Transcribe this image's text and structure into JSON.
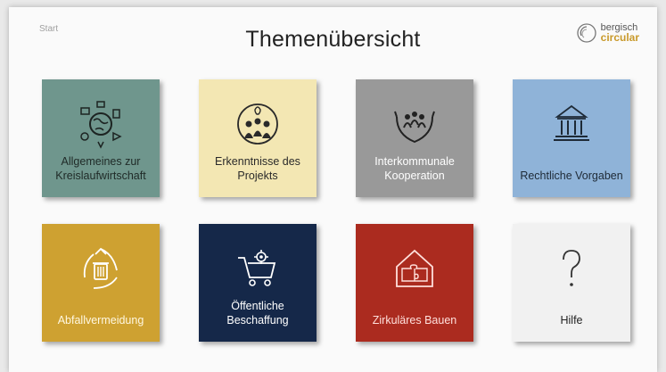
{
  "header": {
    "start_label": "Start",
    "title": "Themenübersicht",
    "logo_line1": "bergisch",
    "logo_line2": "circular"
  },
  "tiles": [
    {
      "label": "Allgemeines zur Kreislaufwirtschaft",
      "color": "#6f968d",
      "text_color": "#1f2a27",
      "icon": "earth-icons"
    },
    {
      "label": "Erkenntnisse des Projekts",
      "color": "#f3e7b3",
      "text_color": "#2a2a2a",
      "icon": "people-lightbulb-icon"
    },
    {
      "label": "Interkommunale Kooperation",
      "color": "#999999",
      "text_color": "#ffffff",
      "icon": "hands-people-icon"
    },
    {
      "label": "Rechtliche Vorgaben",
      "color": "#8fb3d8",
      "text_color": "#1e2a36",
      "icon": "courthouse-icon"
    },
    {
      "label": "Abfallvermeidung",
      "color": "#cea131",
      "text_color": "#fff7e0",
      "icon": "recycle-bin-icon"
    },
    {
      "label": "Öffentliche Beschaffung",
      "color": "#152849",
      "text_color": "#ffffff",
      "icon": "shopping-cart-gear-icon"
    },
    {
      "label": "Zirkuläres Bauen",
      "color": "#ab2b1f",
      "text_color": "#ffe0dc",
      "icon": "house-puzzle-icon"
    },
    {
      "label": "Hilfe",
      "color": "#f1f1f1",
      "text_color": "#222222",
      "icon": "question-mark-icon"
    }
  ]
}
